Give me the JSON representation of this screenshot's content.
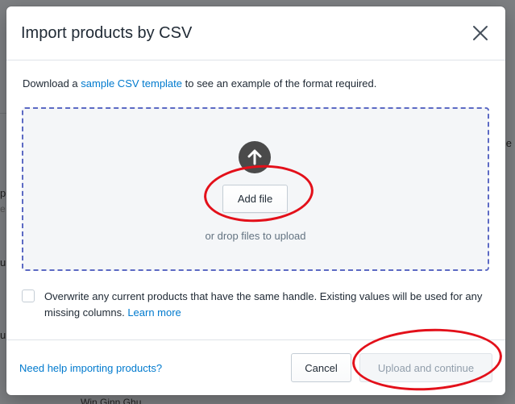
{
  "background": {
    "fragments": [
      "pp",
      "e",
      "u",
      "u",
      "e",
      "Win Ginn Ghu"
    ]
  },
  "modal": {
    "title": "Import products by CSV",
    "intro": {
      "prefix": "Download a ",
      "link_text": "sample CSV template",
      "suffix": " to see an example of the format required."
    },
    "dropzone": {
      "add_file_label": "Add file",
      "drop_hint": "or drop files to upload"
    },
    "overwrite": {
      "checked": false,
      "text": "Overwrite any current products that have the same handle. Existing values will be used for any missing columns. ",
      "learn_more": "Learn more"
    },
    "footer": {
      "help_link": "Need help importing products?",
      "cancel_label": "Cancel",
      "upload_label": "Upload and continue"
    }
  },
  "colors": {
    "accent_link": "#007ace",
    "dropzone_border": "#5c6ac4",
    "annotation_red": "#e3101a"
  },
  "icons": {
    "close": "close-icon",
    "upload": "arrow-up-circle-icon"
  }
}
